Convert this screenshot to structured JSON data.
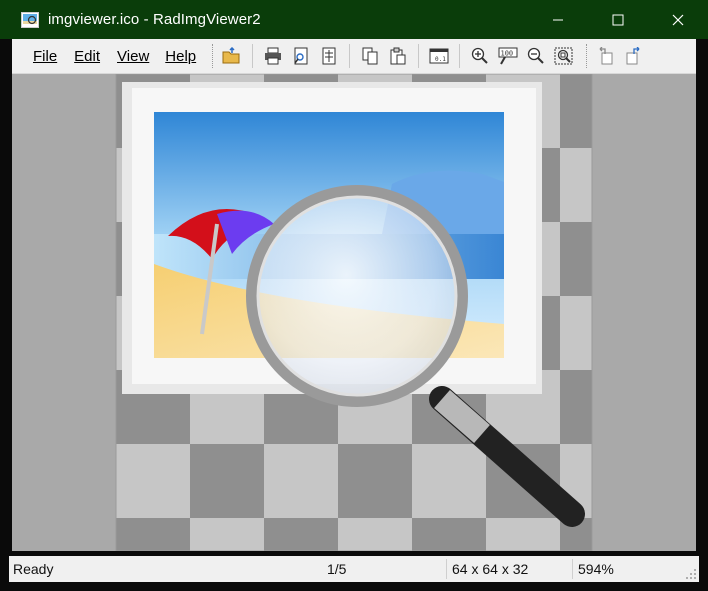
{
  "window": {
    "title": "imgviewer.ico - RadImgViewer2",
    "app_icon": "image-viewer-icon"
  },
  "title_controls": {
    "minimize_icon": "minimize-icon",
    "maximize_icon": "maximize-icon",
    "close_icon": "close-icon"
  },
  "menu": {
    "file": "File",
    "edit": "Edit",
    "view": "View",
    "help": "Help"
  },
  "toolbar": {
    "icons": [
      "open-folder-icon",
      "print-icon",
      "print-preview-icon",
      "properties-icon",
      "copy-icon",
      "paste-icon",
      "slideshow-icon",
      "zoom-in-icon",
      "actual-size-icon",
      "zoom-out-icon",
      "zoom-fit-icon",
      "rotate-left-icon",
      "rotate-right-icon"
    ]
  },
  "image": {
    "description_icon": "image-viewer-magnifier-icon"
  },
  "status": {
    "state": "Ready",
    "frame": "1/5",
    "dimensions": "64 x 64 x 32",
    "zoom": "594%"
  },
  "colors": {
    "titlebar": "#0a3d0a",
    "canvas_bg": "#a9a9a9",
    "chrome": "#f0f0f0"
  }
}
